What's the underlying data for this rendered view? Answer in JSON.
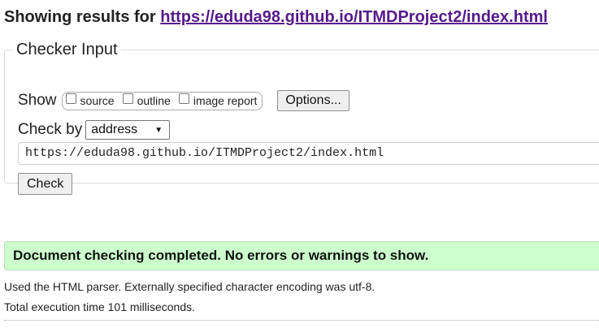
{
  "header": {
    "prefix": "Showing results for",
    "url": "https://eduda98.github.io/ITMDProject2/index.html"
  },
  "checker_input": {
    "legend": "Checker Input",
    "show_label": "Show",
    "show_options": [
      {
        "label": "source",
        "checked": false
      },
      {
        "label": "outline",
        "checked": false
      },
      {
        "label": "image report",
        "checked": false
      }
    ],
    "options_button": "Options...",
    "check_by_label": "Check by",
    "check_by_value": "address",
    "address_value": "https://eduda98.github.io/ITMDProject2/index.html",
    "check_button": "Check"
  },
  "result": {
    "message": "Document checking completed. No errors or warnings to show.",
    "success_color": "#ccffcc",
    "info_lines": [
      "Used the HTML parser. Externally specified character encoding was utf-8.",
      "Total execution time 101 milliseconds."
    ]
  }
}
